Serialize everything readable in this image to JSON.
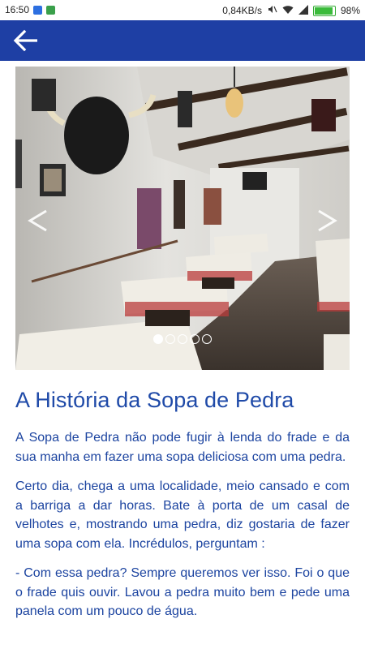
{
  "status_bar": {
    "time": "16:50",
    "network_speed": "0,84KB/s",
    "battery_percent": "98%",
    "battery_level": 0.98
  },
  "app_bar": {
    "back_icon": "arrow-left-icon",
    "color": "#1e3fa4"
  },
  "carousel": {
    "image_description_icon": "restaurant-photo",
    "prev_icon": "chevron-left-icon",
    "next_icon": "chevron-right-icon",
    "total_slides": 5,
    "active_slide": 1
  },
  "article": {
    "title": "A História da Sopa de Pedra",
    "paragraphs": [
      "A Sopa de Pedra não pode fugir à lenda do frade e da sua manha em fazer uma sopa deliciosa com uma pedra.",
      "Certo dia, chega a uma localidade, meio cansado e com a barriga a dar horas. Bate à porta de um casal de velhotes e, mostrando uma pedra, diz gostaria de fazer uma sopa com ela. Incrédulos, perguntam :",
      "- Com essa pedra? Sempre queremos ver isso. Foi o que o frade quis ouvir. Lavou a pedra muito bem e pede uma panela com um pouco de água."
    ]
  },
  "colors": {
    "accent": "#1e3fa4",
    "text": "#1c44a0"
  }
}
